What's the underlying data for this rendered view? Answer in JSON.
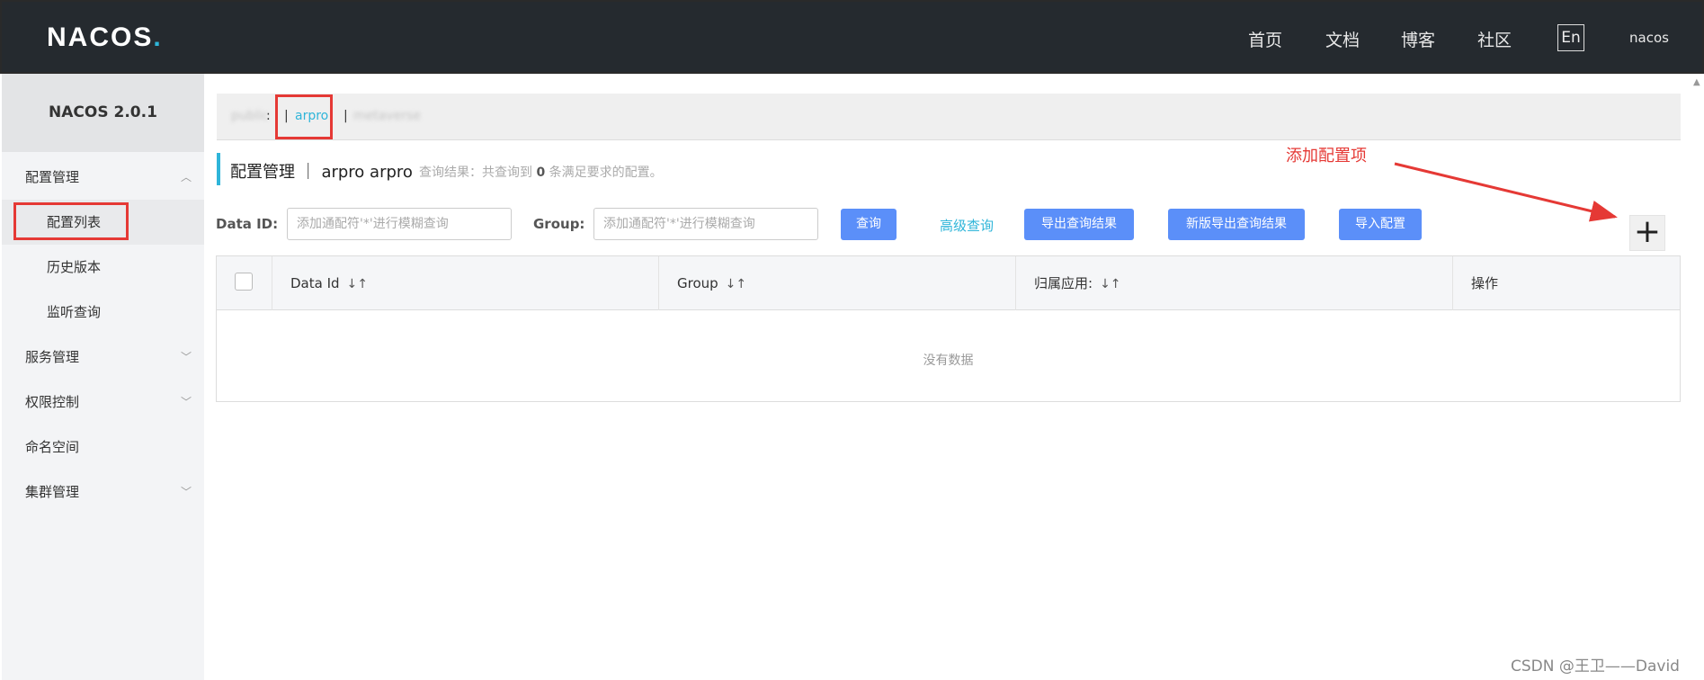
{
  "header": {
    "logo": "NACOS",
    "logo_dot": ".",
    "nav": [
      "首页",
      "文档",
      "博客",
      "社区"
    ],
    "lang": "En",
    "user": "nacos"
  },
  "sidebar": {
    "title": "NACOS 2.0.1",
    "items": [
      {
        "label": "配置管理",
        "expanded": true
      },
      {
        "label": "配置列表",
        "active": true
      },
      {
        "label": "历史版本"
      },
      {
        "label": "监听查询"
      },
      {
        "label": "服务管理"
      },
      {
        "label": "权限控制"
      },
      {
        "label": "命名空间"
      },
      {
        "label": "集群管理"
      }
    ]
  },
  "namespace": {
    "items": [
      "public",
      "arpro",
      "metaverse"
    ],
    "separator": "|",
    "colon": ":"
  },
  "page": {
    "title": "配置管理 ｜ arpro  arpro",
    "result_prefix": "查询结果：共查询到",
    "result_count": "0",
    "result_suffix": "条满足要求的配置。"
  },
  "annotation": {
    "text": "添加配置项",
    "color": "#e53935"
  },
  "search": {
    "dataid_label": "Data ID:",
    "dataid_placeholder": "添加通配符'*'进行模糊查询",
    "group_label": "Group:",
    "group_placeholder": "添加通配符'*'进行模糊查询",
    "query_btn": "查询",
    "advanced": "高级查询",
    "export_btn": "导出查询结果",
    "export_new_btn": "新版导出查询结果",
    "import_btn": "导入配置",
    "add_btn": "+"
  },
  "table": {
    "columns": [
      "Data Id",
      "Group",
      "归属应用:",
      "操作"
    ],
    "sort_icon": "↓↑",
    "empty": "没有数据"
  },
  "watermark": "CSDN @王卫——David",
  "colors": {
    "topbar": "#252a2f",
    "accent": "#2fb5d9",
    "button": "#5b8ff9"
  }
}
